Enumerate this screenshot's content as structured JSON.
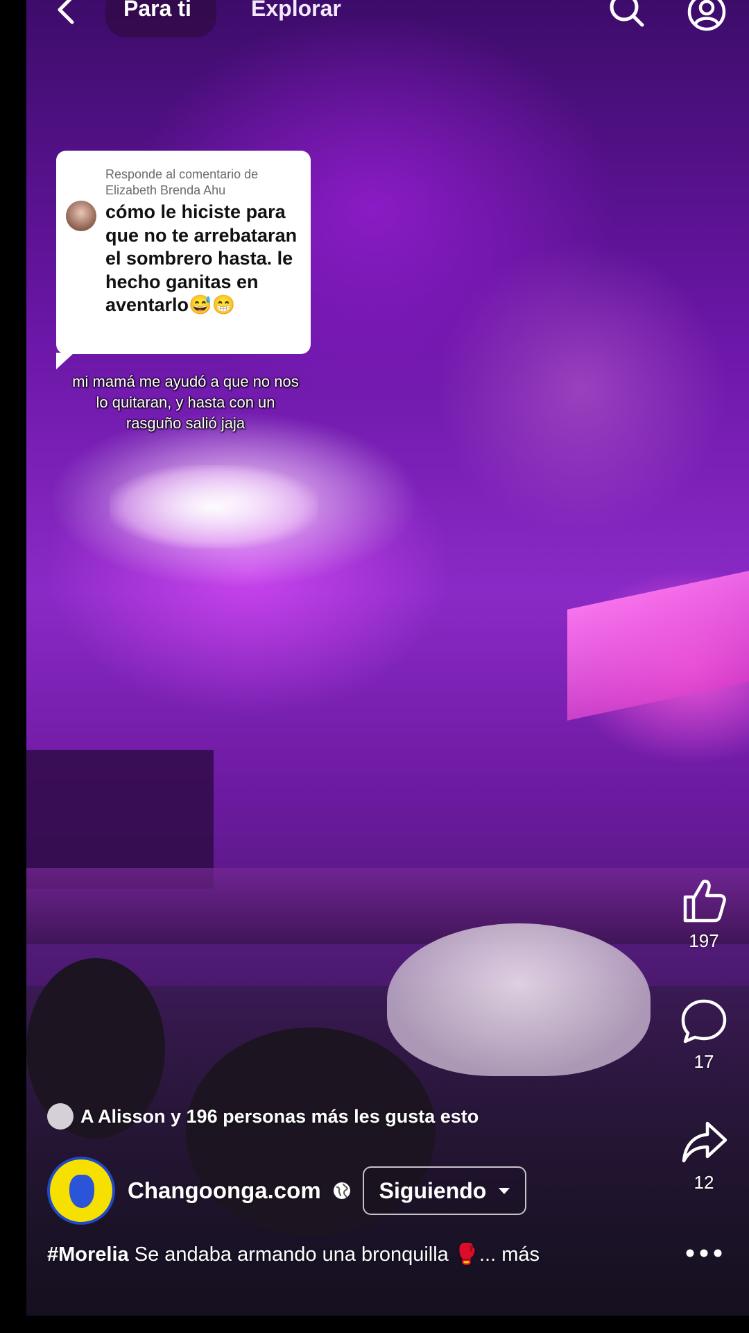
{
  "nav": {
    "tabs": [
      {
        "label": "Para ti",
        "active": true
      },
      {
        "label": "Explorar",
        "active": false
      }
    ],
    "icons": [
      "back-icon",
      "search-icon",
      "profile-icon"
    ]
  },
  "reply_card": {
    "meta": "Responde al comentario de Elizabeth Brenda Ahu",
    "comment": "cómo le hiciste para que no te arrebataran el sombrero hasta. le hecho ganitas en aventarlo😅😁"
  },
  "video_caption": "mi mamá me ayudó a que no nos lo quitaran, y hasta con un rasguño salió jaja",
  "actions": {
    "likes": "197",
    "comments": "17",
    "shares": "12"
  },
  "liked_by": "A Alisson y 196 personas más les gusta esto",
  "page": {
    "name": "Changoonga.com",
    "follow_label": "Siguiendo"
  },
  "description": {
    "hashtag": "#Morelia",
    "text": " Se andaba armando una bronquilla 🥊",
    "more": "... más"
  },
  "colors": {
    "background": "#000000",
    "video_tint": "#8a2ac6",
    "text": "#ffffff"
  }
}
